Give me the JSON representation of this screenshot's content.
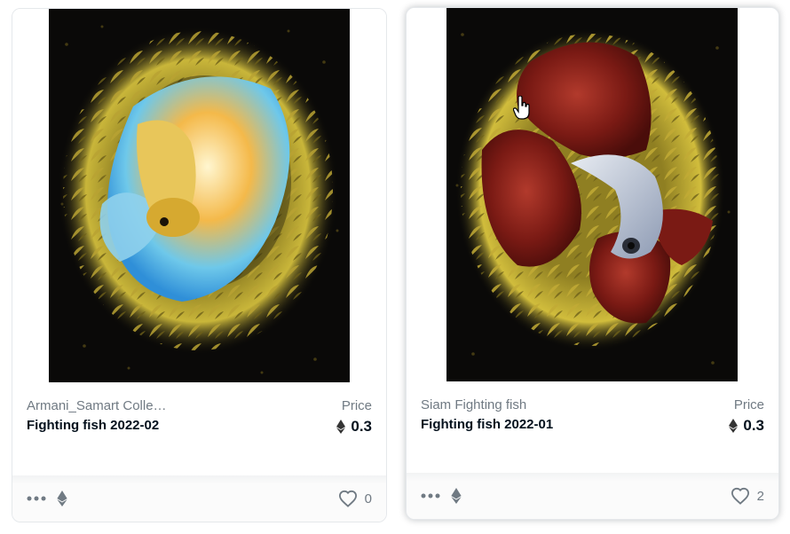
{
  "colors": {
    "text_primary": "#04111d",
    "text_secondary": "#707a83",
    "card_border": "#e5e8eb"
  },
  "cards": [
    {
      "collection": "Armani_Samart Colle…",
      "name": "Fighting fish 2022-02",
      "price_label": "Price",
      "price": "0.3",
      "currency_icon": "ethereum-icon",
      "likes": "0",
      "image_description_icon": "betta-fish-painting-yellow-blue"
    },
    {
      "collection": "Siam Fighting fish",
      "name": "Fighting fish 2022-01",
      "price_label": "Price",
      "price": "0.3",
      "currency_icon": "ethereum-icon",
      "likes": "2",
      "image_description_icon": "betta-fish-painting-red-silver"
    }
  ]
}
